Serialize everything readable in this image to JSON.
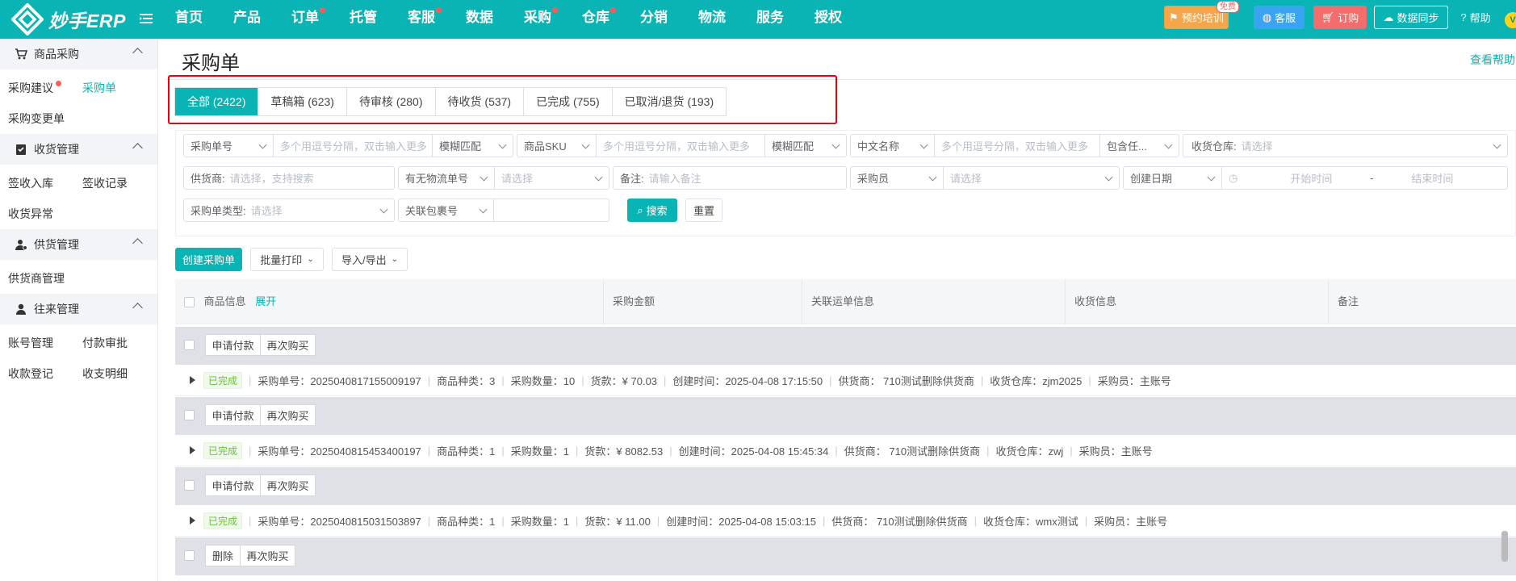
{
  "app": {
    "logo_text": "妙手ERP"
  },
  "nav": [
    {
      "label": "首页",
      "dot": false
    },
    {
      "label": "产品",
      "dot": false
    },
    {
      "label": "订单",
      "dot": true
    },
    {
      "label": "托管",
      "dot": false
    },
    {
      "label": "客服",
      "dot": true
    },
    {
      "label": "数据",
      "dot": false
    },
    {
      "label": "采购",
      "dot": true
    },
    {
      "label": "仓库",
      "dot": true
    },
    {
      "label": "分销",
      "dot": false
    },
    {
      "label": "物流",
      "dot": false
    },
    {
      "label": "服务",
      "dot": false
    },
    {
      "label": "授权",
      "dot": false
    }
  ],
  "topright": {
    "training": "预约培训",
    "free_badge": "免费",
    "service": "客服",
    "order": "订购",
    "sync": "数据同步",
    "help": "帮助",
    "avatar_letter": "V"
  },
  "sidebar": {
    "groups": [
      {
        "title": "商品采购",
        "icon": "cart-icon",
        "items": [
          {
            "label": "采购建议",
            "active": false,
            "dot": true
          },
          {
            "label": "采购单",
            "active": true,
            "dot": false
          },
          {
            "label": "采购变更单",
            "active": false,
            "dot": false
          }
        ]
      },
      {
        "title": "收货管理",
        "icon": "clipboard-icon",
        "items": [
          {
            "label": "签收入库",
            "active": false,
            "dot": false
          },
          {
            "label": "签收记录",
            "active": false,
            "dot": false
          },
          {
            "label": "收货异常",
            "active": false,
            "dot": false
          }
        ]
      },
      {
        "title": "供货管理",
        "icon": "supplier-icon",
        "items": [
          {
            "label": "供货商管理",
            "active": false,
            "dot": false
          }
        ]
      },
      {
        "title": "往来管理",
        "icon": "person-icon",
        "items": [
          {
            "label": "账号管理",
            "active": false,
            "dot": false
          },
          {
            "label": "付款审批",
            "active": false,
            "dot": false
          },
          {
            "label": "收款登记",
            "active": false,
            "dot": false
          },
          {
            "label": "收支明细",
            "active": false,
            "dot": false
          }
        ]
      }
    ]
  },
  "page": {
    "title": "采购单",
    "help_link": "查看帮助"
  },
  "tabs": [
    {
      "label": "全部 (2422)",
      "active": true
    },
    {
      "label": "草稿箱 (623)",
      "active": false
    },
    {
      "label": "待审核 (280)",
      "active": false
    },
    {
      "label": "待收货 (537)",
      "active": false
    },
    {
      "label": "已完成 (755)",
      "active": false
    },
    {
      "label": "已取消/退货 (193)",
      "active": false
    }
  ],
  "filters": {
    "po_no_type": "采购单号",
    "po_no_placeholder": "多个用逗号分隔，双击输入更多",
    "po_no_match": "模糊匹配",
    "sku_type": "商品SKU",
    "sku_placeholder": "多个用逗号分隔，双击输入更多",
    "sku_match": "模糊匹配",
    "cn_name_type": "中文名称",
    "cn_name_placeholder": "多个用逗号分隔，双击输入更多",
    "cn_name_match": "包含任...",
    "warehouse_label": "收货仓库:",
    "warehouse_placeholder": "请选择",
    "supplier_label": "供货商:",
    "supplier_placeholder": "请选择，支持搜索",
    "tracking_type": "有无物流单号",
    "tracking_placeholder": "请选择",
    "remark_label": "备注:",
    "remark_placeholder": "请输入备注",
    "buyer_type": "采购员",
    "buyer_placeholder": "请选择",
    "date_type": "创建日期",
    "date_start": "开始时间",
    "date_sep": "-",
    "date_end": "结束时间",
    "po_type_label": "采购单类型:",
    "po_type_placeholder": "请选择",
    "package_type": "关联包裹号",
    "search": "搜索",
    "reset": "重置"
  },
  "toolbar": {
    "create": "创建采购单",
    "batch_print": "批量打印",
    "import_export": "导入/导出"
  },
  "columns": {
    "product": "商品信息",
    "expand": "展开",
    "amount": "采购金额",
    "shipping": "关联运单信息",
    "receive": "收货信息",
    "remark": "备注"
  },
  "orders": [
    {
      "actions": [
        "申请付款",
        "再次购买"
      ],
      "status": "已完成",
      "po_no": "采购单号：2025040817155009197",
      "kinds": "商品种类：3",
      "qty": "采购数量：10",
      "price": "货款：¥ 70.03",
      "created": "创建时间：2025-04-08 17:15:50",
      "supplier": "供货商： 710测试删除供货商",
      "warehouse": "收货仓库：zjm2025",
      "buyer": "采购员：主账号"
    },
    {
      "actions": [
        "申请付款",
        "再次购买"
      ],
      "status": "已完成",
      "po_no": "采购单号：2025040815453400197",
      "kinds": "商品种类：1",
      "qty": "采购数量：1",
      "price": "货款：¥ 8082.53",
      "created": "创建时间：2025-04-08 15:45:34",
      "supplier": "供货商： 710测试删除供货商",
      "warehouse": "收货仓库：zwj",
      "buyer": "采购员：主账号"
    },
    {
      "actions": [
        "申请付款",
        "再次购买"
      ],
      "status": "已完成",
      "po_no": "采购单号：2025040815031503897",
      "kinds": "商品种类：1",
      "qty": "采购数量：1",
      "price": "货款：¥ 11.00",
      "created": "创建时间：2025-04-08 15:03:15",
      "supplier": "供货商： 710测试删除供货商",
      "warehouse": "收货仓库：wmx测试",
      "buyer": "采购员：主账号"
    },
    {
      "actions": [
        "删除",
        "再次购买"
      ]
    }
  ],
  "colors": {
    "brand": "#0ab4b4",
    "highlight_border": "#e50012"
  }
}
